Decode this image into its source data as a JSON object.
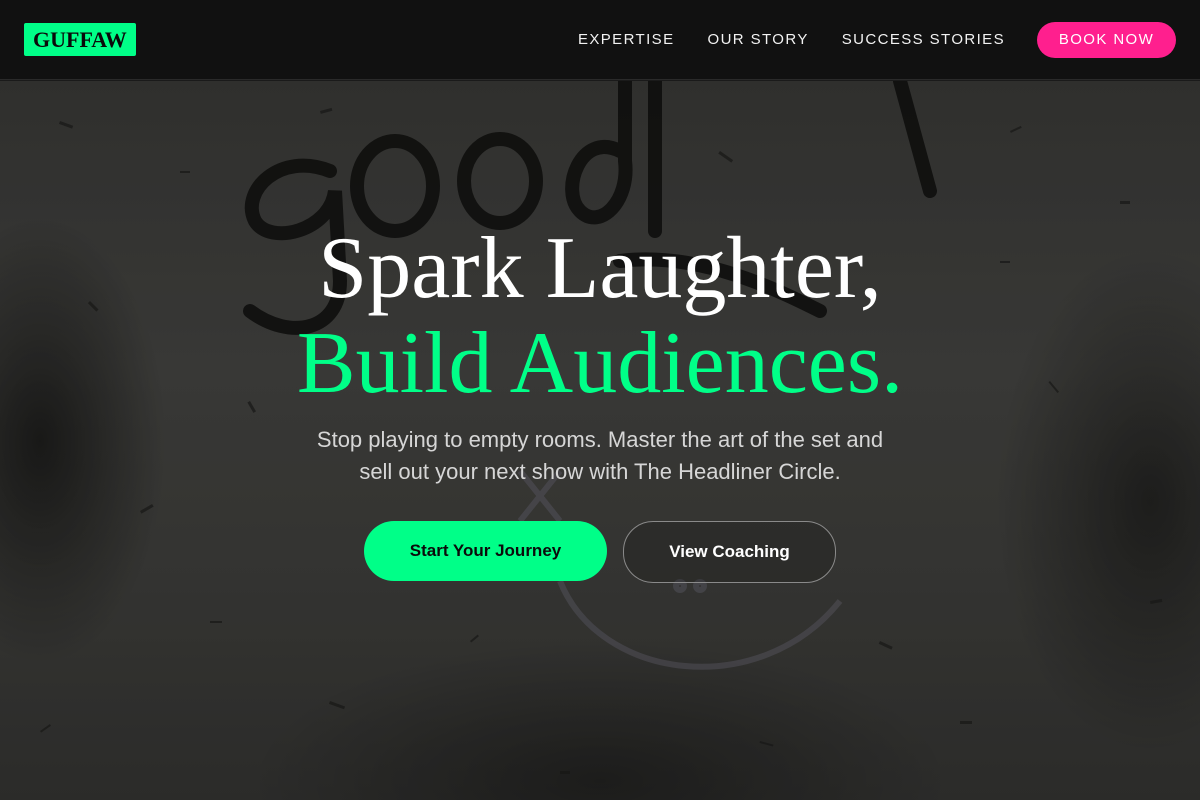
{
  "header": {
    "logo": "GUFFAW",
    "nav": [
      "EXPERTISE",
      "OUR STORY",
      "SUCCESS STORIES"
    ],
    "cta": "BOOK NOW"
  },
  "hero": {
    "headline_line1": "Spark Laughter,",
    "headline_line2": "Build Audiences.",
    "subtitle_line1": "Stop playing to empty rooms. Master the art of the set and",
    "subtitle_line2": "sell out your next show with The Headliner Circle.",
    "primary_button": "Start Your Journey",
    "secondary_button": "View Coaching",
    "background_image": "grafitti-wall-good"
  },
  "colors": {
    "accent_green": "#00ff88",
    "accent_pink": "#ff1f8e",
    "header_bg": "#111111"
  }
}
